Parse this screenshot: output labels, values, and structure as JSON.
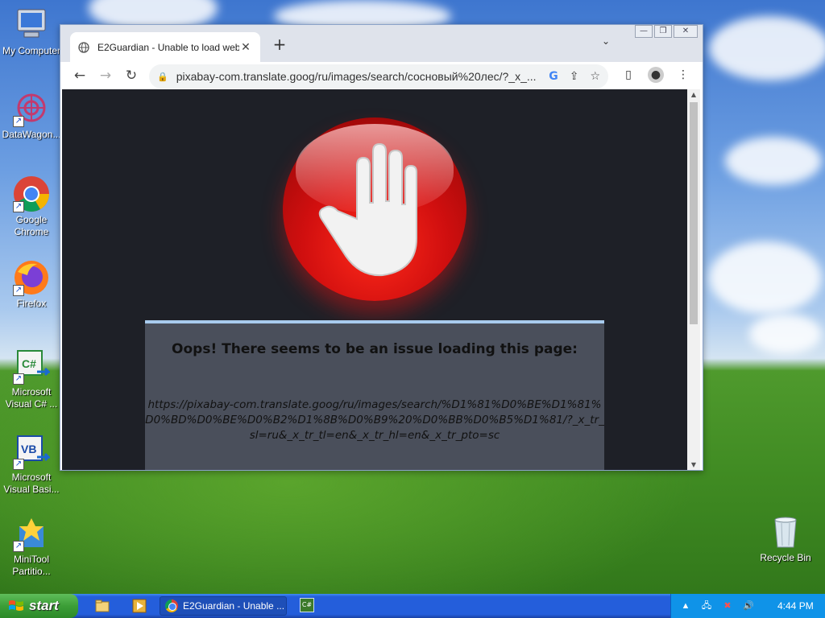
{
  "desktop": {
    "icons": [
      {
        "label": "My Computer"
      },
      {
        "label": "DataWagon..."
      },
      {
        "label": "Google Chrome"
      },
      {
        "label": "Firefox"
      },
      {
        "label": "Microsoft Visual C# ..."
      },
      {
        "label": "Microsoft Visual Basi..."
      },
      {
        "label": "MiniTool Partitio..."
      },
      {
        "label": "Recycle Bin"
      }
    ]
  },
  "browser": {
    "tab_title": "E2Guardian - Unable to load web",
    "tab_close": "✕",
    "new_tab": "+",
    "tab_menu": "⌄",
    "url": "pixabay-com.translate.goog/ru/images/search/сосновый%20лес/?_x_...",
    "window_controls": {
      "minimize": "—",
      "restore": "❐",
      "close": "✕"
    }
  },
  "page": {
    "heading": "Oops! There seems to be an issue loading this page:",
    "blocked_url": "https://pixabay-com.translate.goog/ru/images/search/%D1%81%D0%BE%D1%81%D0%BD%D0%BE%D0%B2%D1%8B%D0%B9%20%D0%BB%D0%B5%D1%81/?_x_tr_sl=ru&_x_tr_tl=en&_x_tr_hl=en&_x_tr_pto=sc"
  },
  "taskbar": {
    "start_label": "start",
    "active_item": "E2Guardian - Unable ...",
    "clock": "4:44 PM"
  },
  "colors": {
    "stop_red": "#d10f0f",
    "page_bg": "#1e2027",
    "error_box": "#4a4f5b",
    "taskbar_blue": "#245edb",
    "start_green": "#3c9e37"
  }
}
